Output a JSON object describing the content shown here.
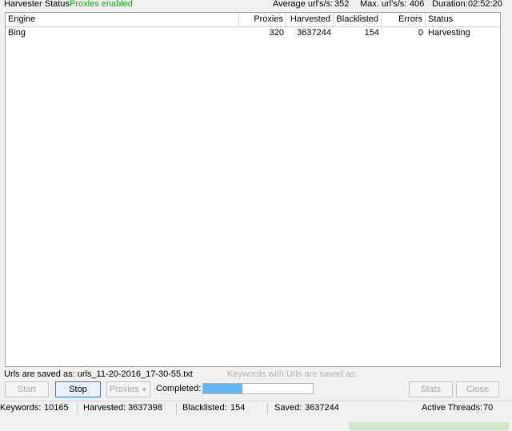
{
  "top": {
    "harvester_label": "Harvester Status:",
    "harvester_value": "Proxies enabled",
    "avg_label": "Average url's/s:",
    "avg_value": "352",
    "max_label": "Max. url's/s:",
    "max_value": "406",
    "duration_label": "Duration:",
    "duration_value": "02:52:20"
  },
  "table": {
    "headers": [
      "Engine",
      "Proxies",
      "Harvested",
      "Blacklisted",
      "Errors",
      "Status"
    ],
    "rows": [
      {
        "engine": "Bing",
        "proxies": "320",
        "harvested": "3637244",
        "blacklisted": "154",
        "errors": "0",
        "status": "Harvesting"
      }
    ]
  },
  "saved": {
    "urls_saved": "Urls are saved as: urls_11-20-2016_17-30-55.txt",
    "keywords_saved": "Keywords with Urls are saved as:"
  },
  "controls": {
    "start": "Start",
    "stop": "Stop",
    "proxies": "Proxies",
    "completed": "Completed:",
    "progress": 0.36,
    "progress_text": "36%",
    "stats": "Stats",
    "close": "Close"
  },
  "bottom": {
    "keywords_label": "Keywords:",
    "keywords_value": "10165",
    "harvested_label": "Harvested:",
    "harvested_value": "3637398",
    "blacklisted_label": "Blacklisted:",
    "blacklisted_value": "154",
    "saved_label": "Saved:",
    "saved_value": "3637244",
    "threads_label": "Active Threads:",
    "threads_value": "70"
  },
  "colors": {
    "accent_green": "#1aa71a",
    "progress": "#63b7f2",
    "button_focus": "#3d7bd9"
  }
}
